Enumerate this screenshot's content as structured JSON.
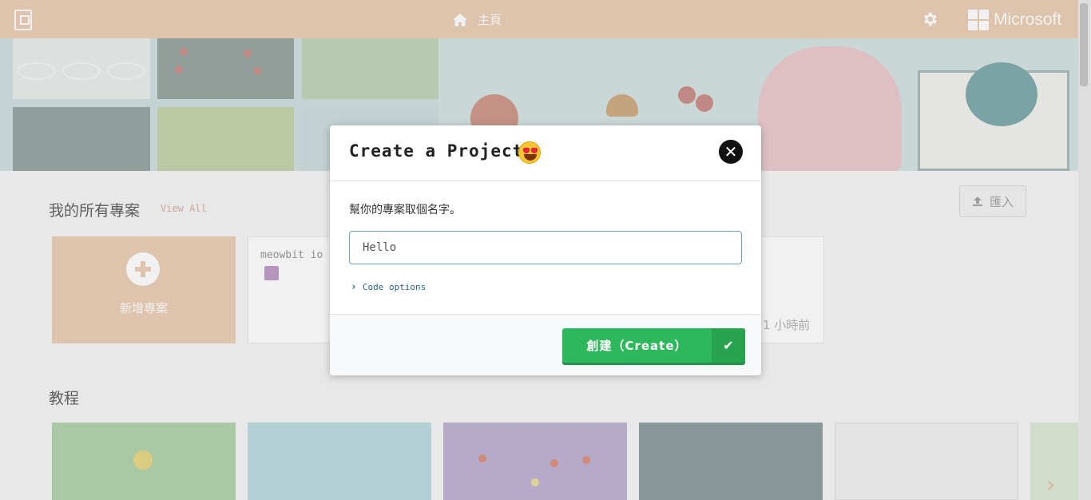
{
  "header": {
    "home_label": "主頁",
    "brand": "Microsoft"
  },
  "projects": {
    "section_title": "我的所有專案",
    "view_all": "View All",
    "import_label": "匯入",
    "new_project_label": "新增專案",
    "items": [
      {
        "name": "meowbit io"
      }
    ],
    "time_ago": "1 小時前"
  },
  "tutorials": {
    "section_title": "教程"
  },
  "modal": {
    "title": "Create a Project",
    "prompt": "幫你的專案取個名字。",
    "input_value": "Hello",
    "code_options": "Code options",
    "create_label": "創建（Create）"
  },
  "colors": {
    "header_bg": "#e8c9ab",
    "accent_green": "#2eb85c",
    "link_blue": "#2b6a87"
  },
  "icons": {
    "logo": "makecode-logo-icon",
    "home": "home-icon",
    "settings": "gear-icon",
    "close": "close-icon",
    "check": "check-icon",
    "chevron": "chevron-right-icon",
    "upload": "upload-icon",
    "plus": "plus-icon"
  }
}
